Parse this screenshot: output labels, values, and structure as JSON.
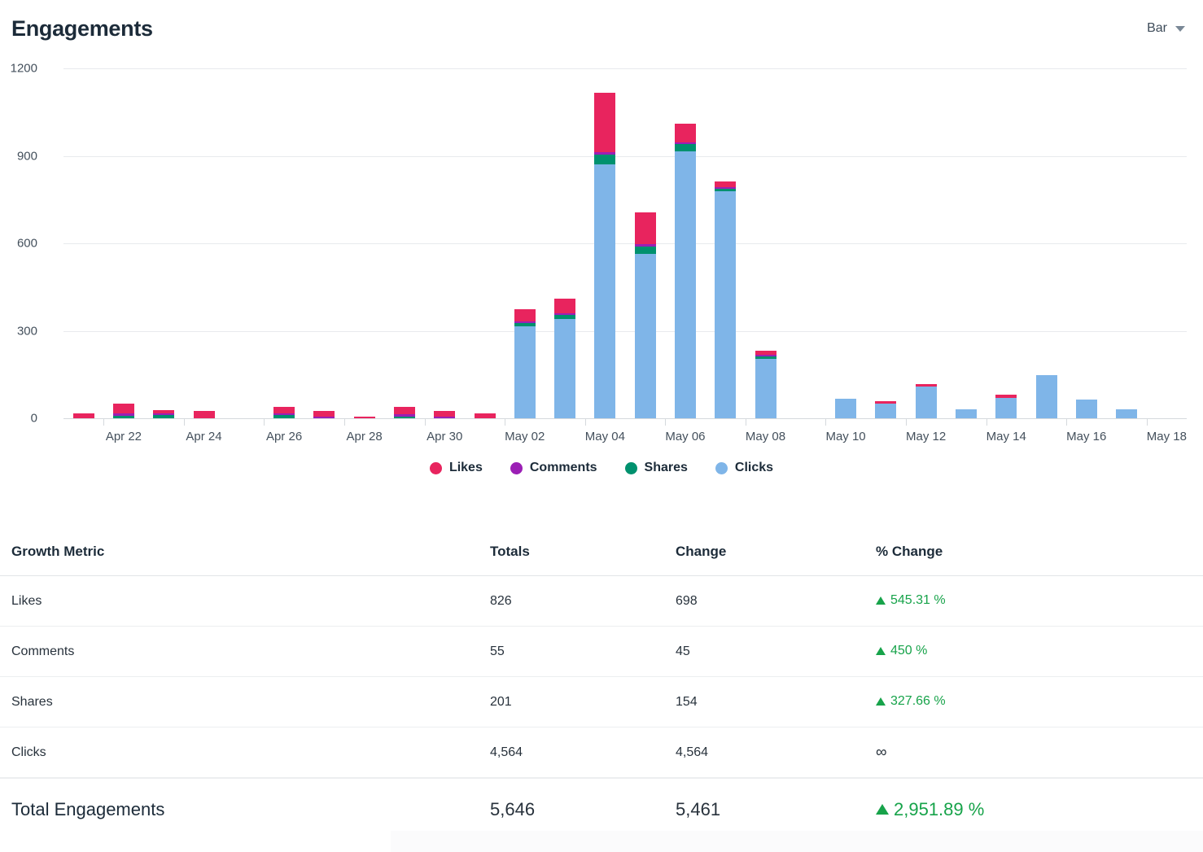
{
  "header": {
    "title": "Engagements",
    "chart_type_label": "Bar",
    "caret_icon": "chevron-down-icon"
  },
  "legend": [
    {
      "label": "Likes",
      "color": "#e8245e"
    },
    {
      "label": "Comments",
      "color": "#9b1fb5"
    },
    {
      "label": "Shares",
      "color": "#00916e"
    },
    {
      "label": "Clicks",
      "color": "#7fb5e8"
    }
  ],
  "table": {
    "columns": [
      "Growth Metric",
      "Totals",
      "Change",
      "% Change"
    ],
    "rows": [
      {
        "metric": "Likes",
        "totals": "826",
        "change": "698",
        "pct": "545.31 %",
        "direction": "up"
      },
      {
        "metric": "Comments",
        "totals": "55",
        "change": "45",
        "pct": "450 %",
        "direction": "up"
      },
      {
        "metric": "Shares",
        "totals": "201",
        "change": "154",
        "pct": "327.66 %",
        "direction": "up"
      },
      {
        "metric": "Clicks",
        "totals": "4,564",
        "change": "4,564",
        "pct": "∞",
        "direction": "none"
      }
    ],
    "total_row": {
      "metric": "Total Engagements",
      "totals": "5,646",
      "change": "5,461",
      "pct": "2,951.89 %",
      "direction": "up"
    }
  },
  "chart_data": {
    "type": "bar",
    "subtype": "stacked",
    "title": "Engagements",
    "xlabel": "",
    "ylabel": "",
    "ylim": [
      0,
      1200
    ],
    "yticks": [
      0,
      300,
      600,
      900,
      1200
    ],
    "grid": true,
    "legend_position": "bottom",
    "stack_order_bottom_to_top": [
      "Clicks",
      "Shares",
      "Comments",
      "Likes"
    ],
    "x_tick_labels": [
      "Apr 22",
      "Apr 24",
      "Apr 26",
      "Apr 28",
      "Apr 30",
      "May 02",
      "May 04",
      "May 06",
      "May 08",
      "May 10",
      "May 12",
      "May 14",
      "May 16",
      "May 18"
    ],
    "categories": [
      "Apr 21",
      "Apr 22",
      "Apr 23",
      "Apr 24",
      "Apr 25",
      "Apr 26",
      "Apr 27",
      "Apr 28",
      "Apr 29",
      "Apr 30",
      "May 01",
      "May 02",
      "May 03",
      "May 04",
      "May 05",
      "May 06",
      "May 07",
      "May 08",
      "May 09",
      "May 10",
      "May 11",
      "May 12",
      "May 13",
      "May 14",
      "May 15",
      "May 16",
      "May 17",
      "May 18"
    ],
    "series": [
      {
        "name": "Likes",
        "color": "#e8245e",
        "values": [
          18,
          33,
          9,
          25,
          0,
          20,
          17,
          5,
          24,
          17,
          18,
          42,
          50,
          205,
          108,
          64,
          17,
          14,
          0,
          0,
          9,
          9,
          0,
          10,
          0,
          0,
          0,
          0
        ]
      },
      {
        "name": "Comments",
        "color": "#9b1fb5",
        "values": [
          0,
          2,
          4,
          0,
          0,
          4,
          2,
          0,
          3,
          2,
          0,
          6,
          7,
          8,
          6,
          5,
          3,
          3,
          0,
          0,
          0,
          0,
          0,
          0,
          0,
          0,
          0,
          0
        ]
      },
      {
        "name": "Shares",
        "color": "#00916e",
        "values": [
          0,
          9,
          11,
          0,
          0,
          11,
          0,
          0,
          7,
          0,
          0,
          11,
          14,
          34,
          25,
          25,
          4,
          4,
          0,
          0,
          0,
          0,
          0,
          0,
          0,
          0,
          0,
          0
        ]
      },
      {
        "name": "Clicks",
        "color": "#7fb5e8",
        "values": [
          0,
          0,
          0,
          0,
          0,
          0,
          0,
          0,
          0,
          0,
          0,
          315,
          340,
          870,
          565,
          915,
          780,
          205,
          0,
          68,
          50,
          108,
          30,
          70,
          148,
          65,
          30,
          0
        ]
      }
    ],
    "totals_per_bar": [
      18,
      44,
      24,
      25,
      0,
      35,
      19,
      5,
      34,
      19,
      18,
      374,
      411,
      1117,
      704,
      1009,
      804,
      226,
      0,
      68,
      59,
      117,
      30,
      80,
      148,
      65,
      30,
      0
    ]
  }
}
